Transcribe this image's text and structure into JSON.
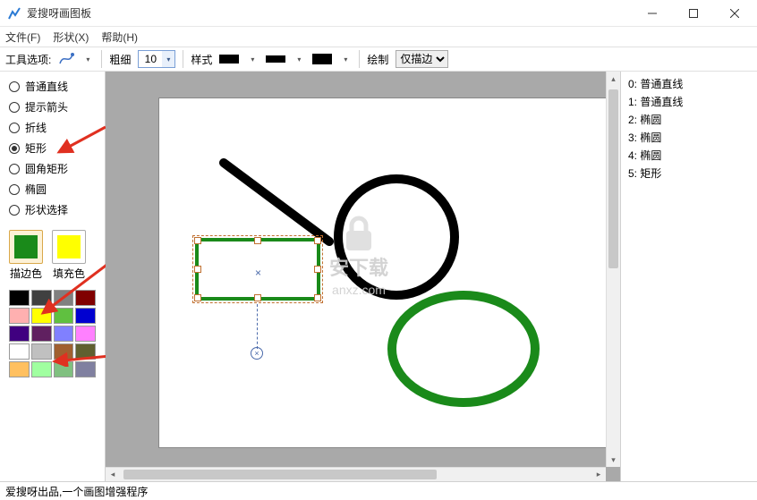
{
  "title": "爱搜呀画图板",
  "menu": {
    "file": "文件(F)",
    "shape": "形状(X)",
    "help": "帮助(H)"
  },
  "toolbar": {
    "tool_opts": "工具选项:",
    "thickness": "粗细",
    "thickness_val": "10",
    "style": "样式",
    "draw": "绘制",
    "draw_opt": "仅描边"
  },
  "shapes": [
    "普通直线",
    "提示箭头",
    "折线",
    "矩形",
    "圆角矩形",
    "椭圆",
    "形状选择"
  ],
  "shape_selected": 3,
  "colors": {
    "stroke_label": "描边色",
    "fill_label": "填充色",
    "stroke_hex": "#1a8a1a",
    "fill_hex": "#ffff00"
  },
  "palette": [
    [
      "#000000",
      "#404040",
      "#808080",
      "#800000"
    ],
    [
      "#ffb0b0",
      "#ffff00",
      "#60c040",
      "#0000d0"
    ],
    [
      "#400080",
      "#602060",
      "#8080ff",
      "#ff80ff"
    ],
    [
      "#ffffff",
      "#c0c0c0",
      "#a06030",
      "#606030"
    ],
    [
      "#ffc060",
      "#a0ffa0",
      "#80c080",
      "#8080a0"
    ]
  ],
  "right_items": [
    "0: 普通直线",
    "1: 普通直线",
    "2: 椭圆",
    "3: 椭圆",
    "4: 椭圆",
    "5: 矩形"
  ],
  "status": "爱搜呀出品,一个画图增强程序",
  "watermark": {
    "line1": "安下载",
    "line2": "anxz.com"
  }
}
